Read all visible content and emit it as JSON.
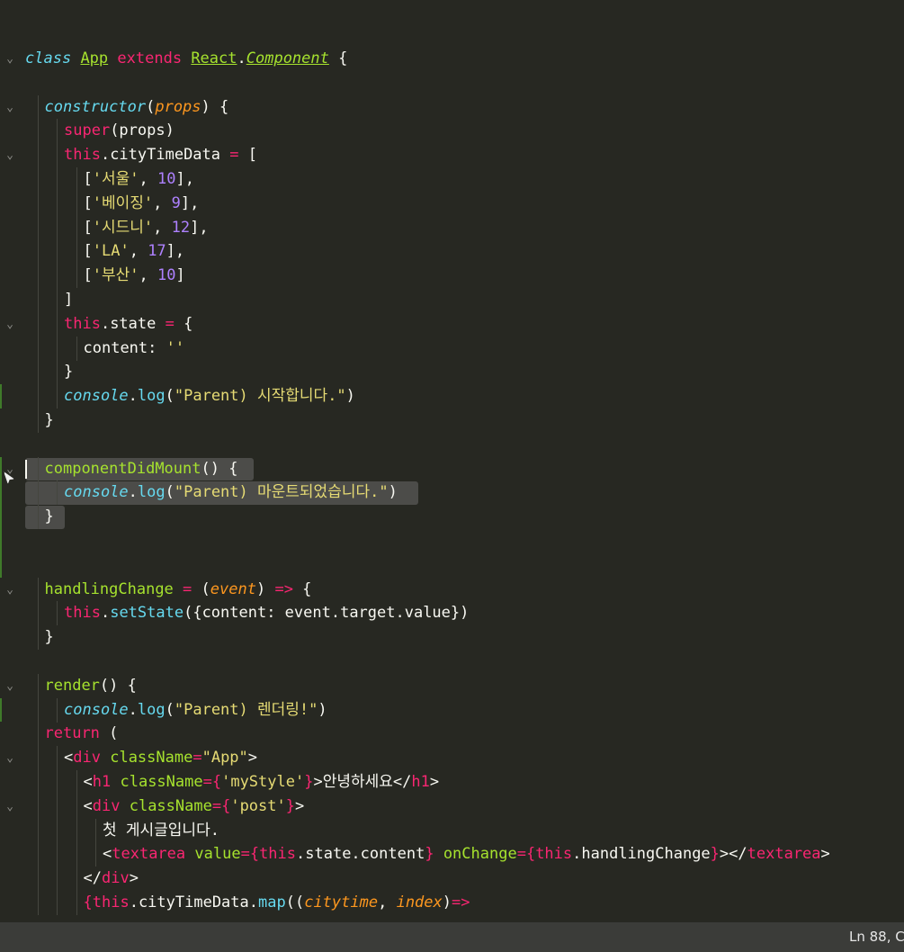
{
  "editor": {
    "language": "JavaScript (React)",
    "theme_colors": {
      "background": "#272822",
      "keyword": "#f92672",
      "function": "#66d9ef",
      "class_name": "#a6e22e",
      "string": "#e6db74",
      "number": "#ae81ff",
      "parameter": "#fd971f",
      "text": "#f8f8f2",
      "selection": "#4c4c49",
      "git_added": "#3f7a2a"
    },
    "lines": [
      {
        "row": 1,
        "fold": true,
        "tokens": [
          [
            "c",
            "class"
          ],
          [
            "w",
            " "
          ],
          [
            "gu",
            "App"
          ],
          [
            "w",
            " "
          ],
          [
            "k",
            "extends"
          ],
          [
            "w",
            " "
          ],
          [
            "gu",
            "React"
          ],
          [
            "w",
            "."
          ],
          [
            "ci",
            "Component"
          ],
          [
            "w",
            " {"
          ]
        ]
      },
      {
        "row": 3,
        "fold": true,
        "tokens": [
          [
            "c",
            "constructor"
          ],
          [
            "w",
            "("
          ],
          [
            "o",
            "props"
          ],
          [
            "w",
            ") {"
          ]
        ]
      },
      {
        "row": 4,
        "tokens": [
          [
            "k",
            "super"
          ],
          [
            "w",
            "(props)"
          ]
        ]
      },
      {
        "row": 5,
        "fold": true,
        "tokens": [
          [
            "k",
            "this"
          ],
          [
            "w",
            ".cityTimeData "
          ],
          [
            "k",
            "="
          ],
          [
            "w",
            " ["
          ]
        ]
      },
      {
        "row": 6,
        "tokens": [
          [
            "w",
            "["
          ],
          [
            "s",
            "'서울'"
          ],
          [
            "w",
            ", "
          ],
          [
            "n",
            "10"
          ],
          [
            "w",
            "],"
          ]
        ]
      },
      {
        "row": 7,
        "tokens": [
          [
            "w",
            "["
          ],
          [
            "s",
            "'베이징'"
          ],
          [
            "w",
            ", "
          ],
          [
            "n",
            "9"
          ],
          [
            "w",
            "],"
          ]
        ]
      },
      {
        "row": 8,
        "tokens": [
          [
            "w",
            "["
          ],
          [
            "s",
            "'시드니'"
          ],
          [
            "w",
            ", "
          ],
          [
            "n",
            "12"
          ],
          [
            "w",
            "],"
          ]
        ]
      },
      {
        "row": 9,
        "tokens": [
          [
            "w",
            "["
          ],
          [
            "s",
            "'LA'"
          ],
          [
            "w",
            ", "
          ],
          [
            "n",
            "17"
          ],
          [
            "w",
            "],"
          ]
        ]
      },
      {
        "row": 10,
        "tokens": [
          [
            "w",
            "["
          ],
          [
            "s",
            "'부산'"
          ],
          [
            "w",
            ", "
          ],
          [
            "n",
            "10"
          ],
          [
            "w",
            "]"
          ]
        ]
      },
      {
        "row": 11,
        "tokens": [
          [
            "w",
            "]"
          ]
        ]
      },
      {
        "row": 12,
        "fold": true,
        "tokens": [
          [
            "k",
            "this"
          ],
          [
            "w",
            ".state "
          ],
          [
            "k",
            "="
          ],
          [
            "w",
            " {"
          ]
        ]
      },
      {
        "row": 13,
        "tokens": [
          [
            "w",
            "content: "
          ],
          [
            "s",
            "''"
          ]
        ]
      },
      {
        "row": 14,
        "tokens": [
          [
            "w",
            "}"
          ]
        ]
      },
      {
        "row": 15,
        "tokens": [
          [
            "c",
            "console"
          ],
          [
            "w",
            "."
          ],
          [
            "f",
            "log"
          ],
          [
            "w",
            "("
          ],
          [
            "s",
            "\"Parent) 시작합니다.\""
          ],
          [
            "w",
            ")"
          ]
        ]
      },
      {
        "row": 16,
        "tokens": [
          [
            "w",
            "}"
          ]
        ]
      },
      {
        "row": 18,
        "fold": true,
        "tokens": [
          [
            "g",
            "componentDidMount"
          ],
          [
            "w",
            "() {"
          ]
        ]
      },
      {
        "row": 19,
        "tokens": [
          [
            "c",
            "console"
          ],
          [
            "w",
            "."
          ],
          [
            "f",
            "log"
          ],
          [
            "w",
            "("
          ],
          [
            "s",
            "\"Parent) 마운트되었습니다.\""
          ],
          [
            "w",
            ")"
          ]
        ]
      },
      {
        "row": 20,
        "tokens": [
          [
            "w",
            "}"
          ]
        ]
      },
      {
        "row": 23,
        "fold": true,
        "tokens": [
          [
            "g",
            "handlingChange"
          ],
          [
            "w",
            " "
          ],
          [
            "k",
            "="
          ],
          [
            "w",
            " ("
          ],
          [
            "o",
            "event"
          ],
          [
            "w",
            ") "
          ],
          [
            "k",
            "=>"
          ],
          [
            "w",
            " {"
          ]
        ]
      },
      {
        "row": 24,
        "tokens": [
          [
            "k",
            "this"
          ],
          [
            "w",
            "."
          ],
          [
            "f",
            "setState"
          ],
          [
            "w",
            "({content: event.target.value})"
          ]
        ]
      },
      {
        "row": 25,
        "tokens": [
          [
            "w",
            "}"
          ]
        ]
      },
      {
        "row": 27,
        "fold": true,
        "tokens": [
          [
            "g",
            "render"
          ],
          [
            "w",
            "() {"
          ]
        ]
      },
      {
        "row": 28,
        "tokens": [
          [
            "c",
            "console"
          ],
          [
            "w",
            "."
          ],
          [
            "f",
            "log"
          ],
          [
            "w",
            "("
          ],
          [
            "s",
            "\"Parent) 렌더링!\""
          ],
          [
            "w",
            ")"
          ]
        ]
      },
      {
        "row": 29,
        "tokens": [
          [
            "k",
            "return"
          ],
          [
            "w",
            " ("
          ]
        ]
      },
      {
        "row": 30,
        "fold": true,
        "tokens": [
          [
            "w",
            "<"
          ],
          [
            "k",
            "div"
          ],
          [
            "w",
            " "
          ],
          [
            "g",
            "className"
          ],
          [
            "k",
            "="
          ],
          [
            "s",
            "\"App\""
          ],
          [
            "w",
            ">"
          ]
        ]
      },
      {
        "row": 31,
        "tokens": [
          [
            "w",
            "<"
          ],
          [
            "k",
            "h1"
          ],
          [
            "w",
            " "
          ],
          [
            "g",
            "className"
          ],
          [
            "k",
            "={"
          ],
          [
            "s",
            "'myStyle'"
          ],
          [
            "k",
            "}"
          ],
          [
            "w",
            ">안녕하세요</"
          ],
          [
            "k",
            "h1"
          ],
          [
            "w",
            ">"
          ]
        ]
      },
      {
        "row": 32,
        "fold": true,
        "tokens": [
          [
            "w",
            "<"
          ],
          [
            "k",
            "div"
          ],
          [
            "w",
            " "
          ],
          [
            "g",
            "className"
          ],
          [
            "k",
            "={"
          ],
          [
            "s",
            "'post'"
          ],
          [
            "k",
            "}"
          ],
          [
            "w",
            ">"
          ]
        ]
      },
      {
        "row": 33,
        "tokens": [
          [
            "w",
            "첫 게시글입니다."
          ]
        ]
      },
      {
        "row": 34,
        "tokens": [
          [
            "w",
            "<"
          ],
          [
            "k",
            "textarea"
          ],
          [
            "w",
            " "
          ],
          [
            "g",
            "value"
          ],
          [
            "k",
            "={"
          ],
          [
            "k",
            "this"
          ],
          [
            "w",
            ".state.content"
          ],
          [
            "k",
            "}"
          ],
          [
            "w",
            " "
          ],
          [
            "g",
            "onChange"
          ],
          [
            "k",
            "={"
          ],
          [
            "k",
            "this"
          ],
          [
            "w",
            ".handlingChange"
          ],
          [
            "k",
            "}"
          ],
          [
            "w",
            "></"
          ],
          [
            "k",
            "textarea"
          ],
          [
            "w",
            ">"
          ]
        ]
      },
      {
        "row": 35,
        "tokens": [
          [
            "w",
            "</"
          ],
          [
            "k",
            "div"
          ],
          [
            "w",
            ">"
          ]
        ]
      },
      {
        "row": 36,
        "tokens": [
          [
            "k",
            "{"
          ],
          [
            "k",
            "this"
          ],
          [
            "w",
            ".cityTimeData."
          ],
          [
            "f",
            "map"
          ],
          [
            "w",
            "(("
          ],
          [
            "o",
            "citytime"
          ],
          [
            "w",
            ", "
          ],
          [
            "o",
            "index"
          ],
          [
            "w",
            ")"
          ],
          [
            "k",
            "=>"
          ]
        ]
      }
    ]
  },
  "status_bar": {
    "cursor_position": "Ln 88, C"
  }
}
